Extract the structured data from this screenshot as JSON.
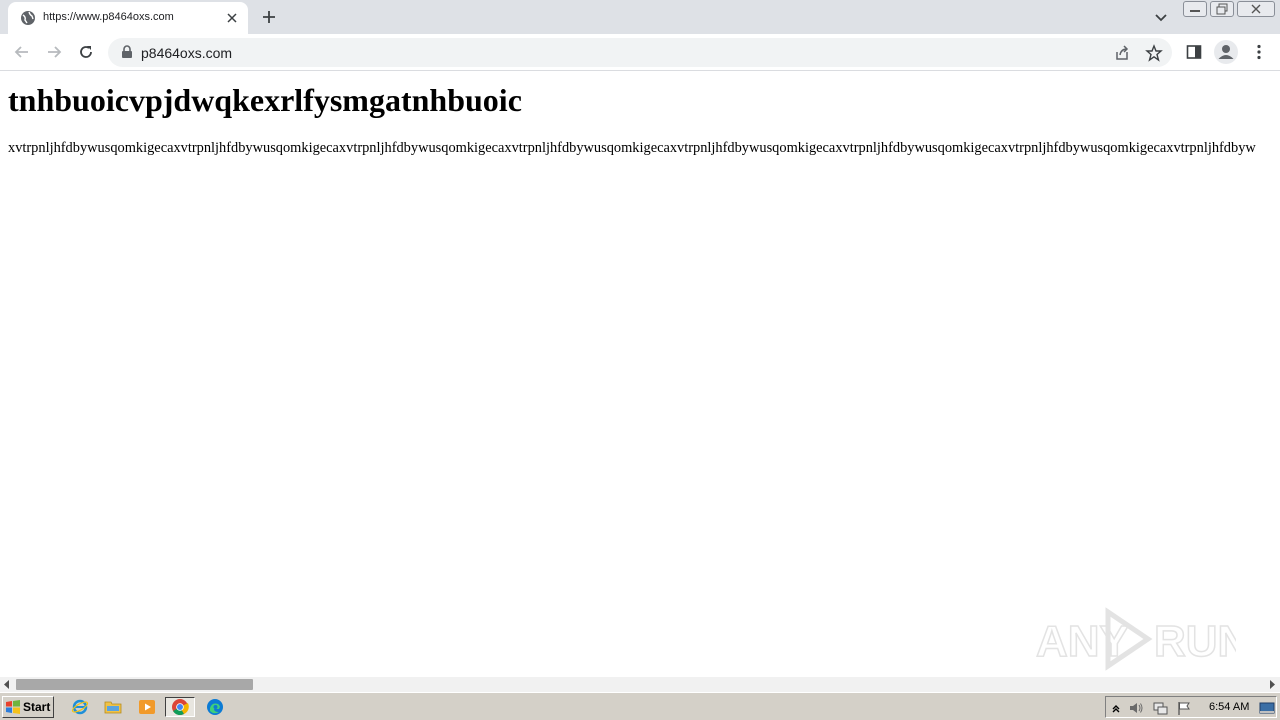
{
  "browser": {
    "tab": {
      "title": "https://www.p8464oxs.com"
    },
    "address_bar": {
      "url": "p8464oxs.com"
    }
  },
  "page": {
    "heading": "tnhbuoicvpjdwqkexrlfysmgatnhbuoic",
    "paragraph": "xvtrpnljhfdbywusqomkigecaxvtrpnljhfdbywusqomkigecaxvtrpnljhfdbywusqomkigecaxvtrpnljhfdbywusqomkigecaxvtrpnljhfdbywusqomkigecaxvtrpnljhfdbywusqomkigecaxvtrpnljhfdbywusqomkigecaxvtrpnljhfdbyw"
  },
  "watermark": {
    "text": "ANY RUN"
  },
  "taskbar": {
    "start_label": "Start",
    "clock": "6:54 AM",
    "apps": [
      "internet-explorer-icon",
      "file-explorer-icon",
      "media-player-icon",
      "chrome-icon",
      "edge-icon"
    ]
  },
  "colors": {
    "tabstrip": "#dee1e6",
    "omnibox": "#f1f3f4",
    "taskbar": "#d4d0c8",
    "scroll_thumb": "#a8a8a8"
  }
}
